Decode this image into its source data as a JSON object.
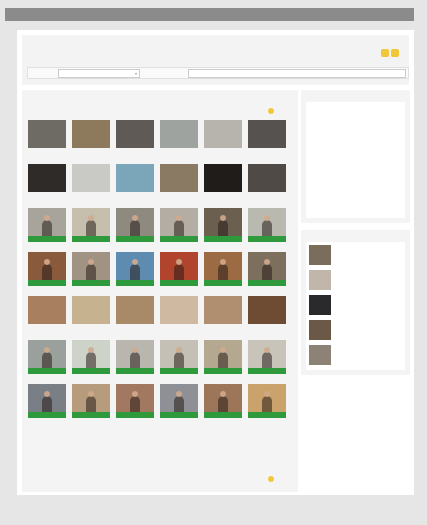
{
  "topbar": {
    "left": "",
    "right_1": "",
    "right_2": ""
  },
  "header": {
    "logo": "",
    "tagline": ""
  },
  "searchbar": {
    "category_label": "",
    "category_value": "",
    "keyword_label": "",
    "keyword_placeholder": ""
  },
  "main": {
    "title": "",
    "sort": {
      "left_1": "",
      "left_2": "",
      "left_3": "",
      "left_4": "",
      "right_1": "",
      "right_2": "",
      "right_3": ""
    },
    "pager": {
      "left": "",
      "right_1": "",
      "right_2": ""
    },
    "thumbnails": [
      {
        "bg": "#6e6a64",
        "cap": ""
      },
      {
        "bg": "#8d7a5c",
        "cap": ""
      },
      {
        "bg": "#5f5a55",
        "cap": ""
      },
      {
        "bg": "#9fa3a0",
        "cap": ""
      },
      {
        "bg": "#b7b3ad",
        "cap": ""
      },
      {
        "bg": "#55524f",
        "cap": ""
      },
      {
        "bg": "#2f2b28",
        "cap": ""
      },
      {
        "bg": "#c9c9c6",
        "cap": ""
      },
      {
        "bg": "#7ba5b8",
        "cap": ""
      },
      {
        "bg": "#8a7a63",
        "cap": ""
      },
      {
        "bg": "#1f1c1a",
        "cap": ""
      },
      {
        "bg": "#4f4a45",
        "cap": ""
      },
      {
        "bg": "#a8a49b",
        "cap": "#2f9a3c"
      },
      {
        "bg": "#c6bfae",
        "cap": "#2f9a3c"
      },
      {
        "bg": "#8f8a80",
        "cap": "#2f9a3c"
      },
      {
        "bg": "#b4ada3",
        "cap": "#2f9a3c"
      },
      {
        "bg": "#6b5f50",
        "cap": "#2f9a3c"
      },
      {
        "bg": "#b9b9b0",
        "cap": "#2f9a3c"
      },
      {
        "bg": "#8a5a3c",
        "cap": "#2f9a3c"
      },
      {
        "bg": "#a09384",
        "cap": "#2f9a3c"
      },
      {
        "bg": "#5d8cb0",
        "cap": "#2f9a3c"
      },
      {
        "bg": "#b0442c",
        "cap": "#2f9a3c"
      },
      {
        "bg": "#9c6a43",
        "cap": "#2f9a3c"
      },
      {
        "bg": "#7c6f5e",
        "cap": "#2f9a3c"
      },
      {
        "bg": "#a88060",
        "cap": ""
      },
      {
        "bg": "#c7b28f",
        "cap": ""
      },
      {
        "bg": "#a88a68",
        "cap": ""
      },
      {
        "bg": "#cfb9a0",
        "cap": ""
      },
      {
        "bg": "#b08e70",
        "cap": ""
      },
      {
        "bg": "#6e4b33",
        "cap": ""
      },
      {
        "bg": "#9aa09b",
        "cap": "#2f9a3c"
      },
      {
        "bg": "#cdd3c8",
        "cap": "#2f9a3c"
      },
      {
        "bg": "#b8b6ae",
        "cap": "#2f9a3c"
      },
      {
        "bg": "#c4c0b6",
        "cap": "#2f9a3c"
      },
      {
        "bg": "#b5a890",
        "cap": "#2f9a3c"
      },
      {
        "bg": "#c8c4ba",
        "cap": "#2f9a3c"
      },
      {
        "bg": "#7a7f86",
        "cap": "#2f9a3c"
      },
      {
        "bg": "#b79b7d",
        "cap": "#2f9a3c"
      },
      {
        "bg": "#a27860",
        "cap": "#2f9a3c"
      },
      {
        "bg": "#8f9096",
        "cap": "#2f9a3c"
      },
      {
        "bg": "#9d7558",
        "cap": "#2f9a3c"
      },
      {
        "bg": "#c9a36b",
        "cap": "#2f9a3c"
      }
    ]
  },
  "news": {
    "title": "",
    "items": [
      {
        "date": "",
        "title": ""
      },
      {
        "date": "",
        "title": ""
      },
      {
        "date": "",
        "title": ""
      },
      {
        "date": "",
        "title": ""
      },
      {
        "date": "",
        "title": ""
      },
      {
        "date": "",
        "title": ""
      },
      {
        "date": "",
        "title": ""
      },
      {
        "date": "",
        "title": ""
      },
      {
        "date": "",
        "title": ""
      },
      {
        "date": "",
        "title": ""
      }
    ]
  },
  "ranking": {
    "title": "",
    "items": [
      {
        "thumb": "#7a6d5c",
        "title": "",
        "stars": "",
        "meta": ""
      },
      {
        "thumb": "#c0b6aa",
        "title": "",
        "stars": "",
        "meta": ""
      },
      {
        "thumb": "#2a2a2c",
        "title": "",
        "stars": "",
        "meta": ""
      },
      {
        "thumb": "#6c5847",
        "title": "",
        "stars": "",
        "meta": ""
      },
      {
        "thumb": "#8c8276",
        "title": "",
        "stars": "",
        "meta": ""
      }
    ]
  },
  "footer": {
    "text": ""
  },
  "colors": {
    "accent": "#f1c73a",
    "green": "#2f9a3c",
    "topbar": "#8b8b8b"
  }
}
